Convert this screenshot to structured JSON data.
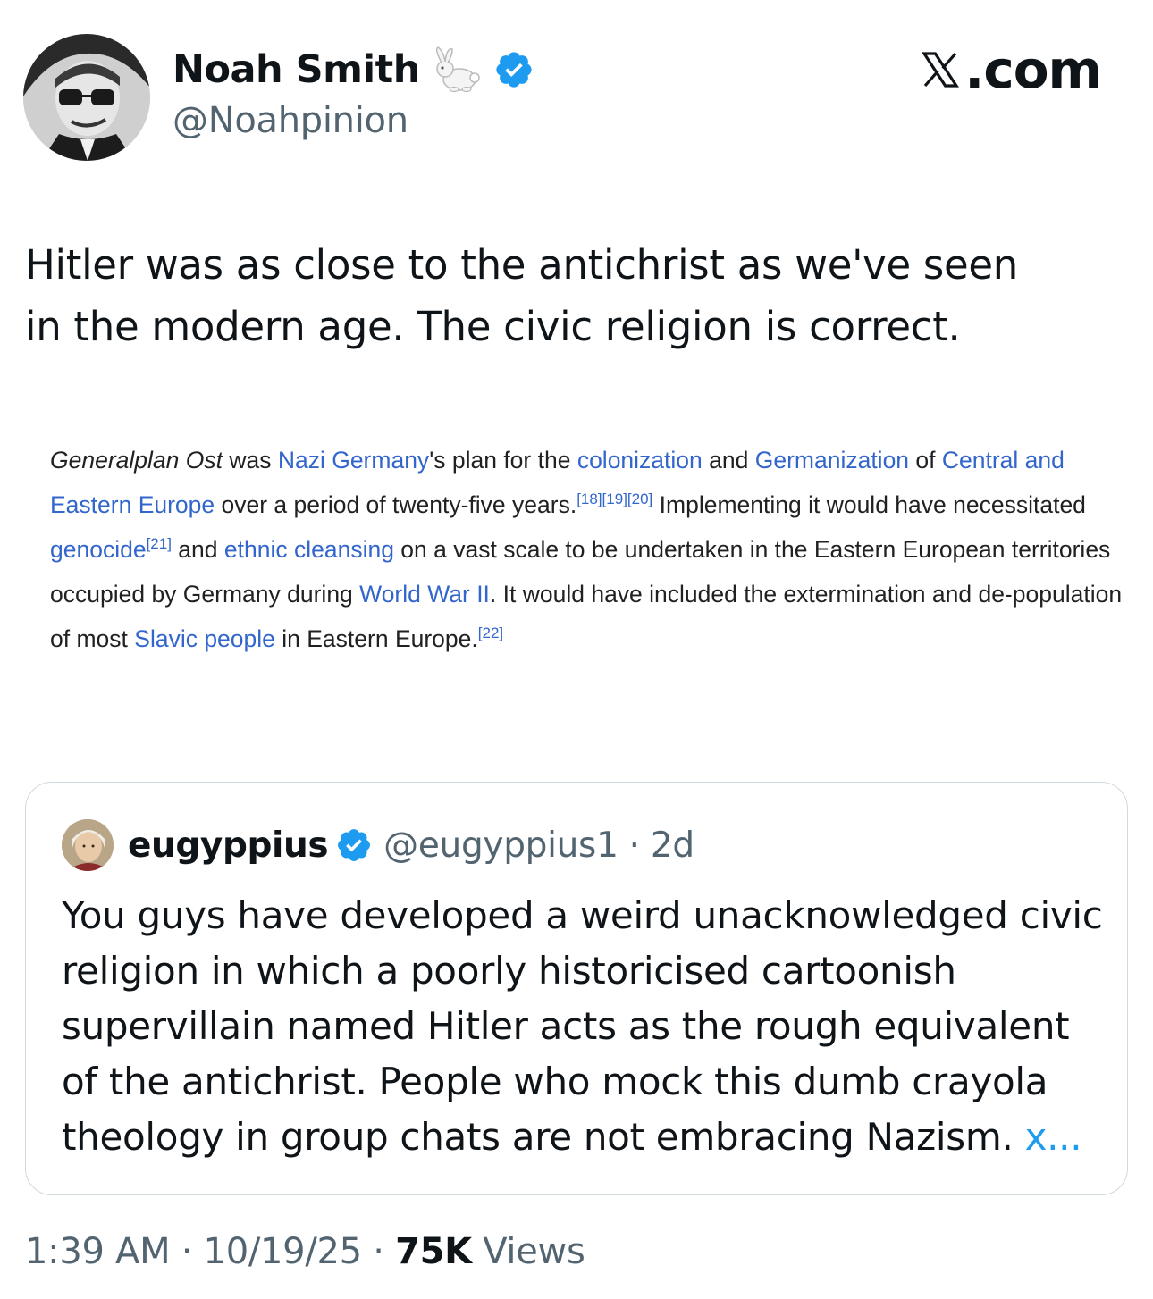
{
  "author": {
    "name": "Noah Smith",
    "handle": "@Noahpinion",
    "badge_color": "#1d9bf0",
    "name_emoji": "rabbit-icon"
  },
  "site_label": ".com",
  "tweet": {
    "line1": "Hitler was as close to the antichrist as we've seen",
    "line2": "in the modern age. The civic religion is correct."
  },
  "wiki_excerpt": {
    "s1": "Generalplan Ost",
    "s2": " was ",
    "l1": "Nazi Germany",
    "s3": "'s plan for the ",
    "l2": "colonization",
    "s4": " and ",
    "l3": "Germanization",
    "s5": " of ",
    "l4": "Central and Eastern Europe",
    "s6": " over a period of twenty-five years.",
    "r1": "[18][19][20]",
    "s7": " Implementing it would have necessitated ",
    "l5": "genocide",
    "r2": "[21]",
    "s8": " and ",
    "l6": "ethnic cleansing",
    "s9": " on a vast scale to be undertaken in the Eastern European territories occupied by Germany during ",
    "l7": "World War II",
    "s10": ". It would have included the extermination and de-population of most ",
    "l8": "Slavic people",
    "s11": " in Eastern Europe.",
    "r3": "[22]",
    "link_color": "#3366cc"
  },
  "quoted": {
    "name": "eugyppius",
    "handle": "@eugyppius1 · 2d",
    "text": "You guys have developed a weird unacknowledged civic religion in which a poorly historicised cartoonish supervillain named Hitler acts as the rough equivalent of the antichrist. People who mock this dumb crayola theology in group chats are not embracing Nazism.",
    "more": "x..."
  },
  "meta": {
    "timestamp": "1:39 AM · 10/19/25 · ",
    "views_count": "75K",
    "views_label": " Views"
  }
}
